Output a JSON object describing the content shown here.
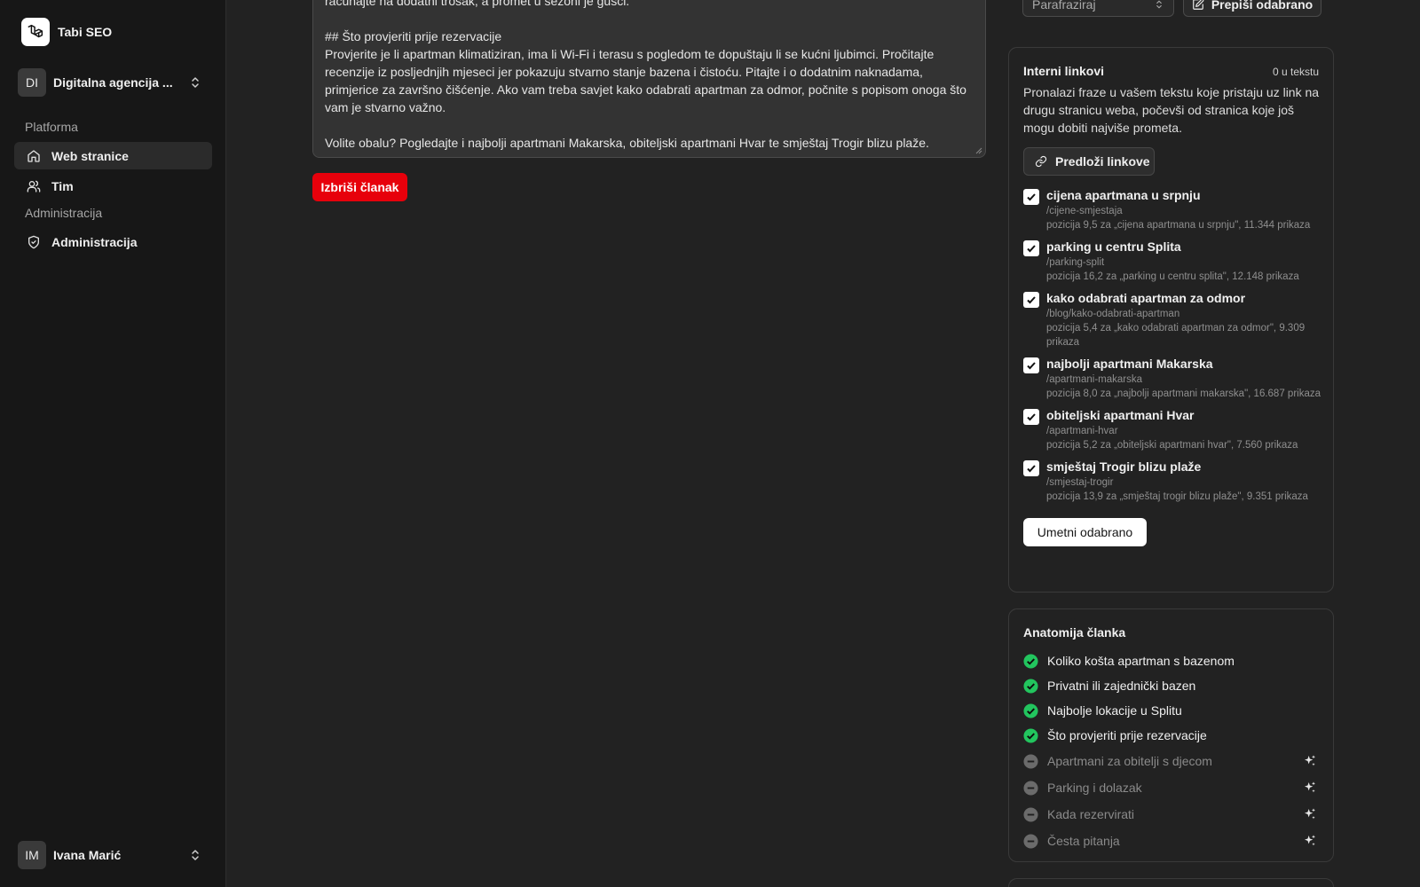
{
  "app": {
    "name": "Tabi SEO"
  },
  "team": {
    "initials": "DI",
    "name": "Digitalna agencija ..."
  },
  "nav": {
    "group_platform": "Platforma",
    "web_pages": "Web stranice",
    "team": "Tim",
    "group_admin": "Administracija",
    "admin": "Administracija"
  },
  "user": {
    "initials": "IM",
    "name": "Ivana Marić"
  },
  "editor": {
    "partial_line": "računajte na dodatni trošak, a promet u sezoni je gušći.",
    "heading": "## Što provjeriti prije rezervacije",
    "paragraph": "Provjerite je li apartman klimatiziran, ima li Wi-Fi i terasu s pogledom te dopuštaju li se kućni ljubimci. Pročitajte recenzije iz posljednjih mjeseci jer pokazuju stvarno stanje bazena i čistoću. Pitajte i o dodatnim naknadama, primjerice za završno čišćenje. Ako vam treba savjet kako odabrati apartman za odmor, počnite s popisom onoga što vam je stvarno važno.",
    "closing": "Volite obalu? Pogledajte i najbolji apartmani Makarska, obiteljski apartmani Hvar te smještaj Trogir blizu plaže."
  },
  "delete_button": "Izbriši članak",
  "rewrite": {
    "mode": "Parafraziraj",
    "button": "Prepiši odabrano"
  },
  "internal_links": {
    "title": "Interni linkovi",
    "count": "0 u tekstu",
    "description": "Pronalazi fraze u vašem tekstu koje pristaju uz link na drugu stranicu weba, počevši od stranica koje još mogu dobiti najviše prometa.",
    "suggest_button": "Predloži linkove",
    "insert_button": "Umetni odabrano",
    "items": [
      {
        "checked": true,
        "title": "cijena apartmana u srpnju",
        "url": "/cijene-smjestaja",
        "meta": "pozicija 9,5 za „cijena apartmana u srpnju\", 11.344 prikaza"
      },
      {
        "checked": true,
        "title": "parking u centru Splita",
        "url": "/parking-split",
        "meta": "pozicija 16,2 za „parking u centru splita\", 12.148 prikaza"
      },
      {
        "checked": true,
        "title": "kako odabrati apartman za odmor",
        "url": "/blog/kako-odabrati-apartman",
        "meta": "pozicija 5,4 za „kako odabrati apartman za odmor\", 9.309 prikaza"
      },
      {
        "checked": true,
        "title": "najbolji apartmani Makarska",
        "url": "/apartmani-makarska",
        "meta": "pozicija 8,0 za „najbolji apartmani makarska\", 16.687 prikaza"
      },
      {
        "checked": true,
        "title": "obiteljski apartmani Hvar",
        "url": "/apartmani-hvar",
        "meta": "pozicija 5,2 za „obiteljski apartmani hvar\", 7.560 prikaza"
      },
      {
        "checked": true,
        "title": "smještaj Trogir blizu plaže",
        "url": "/smjestaj-trogir",
        "meta": "pozicija 13,9 za „smještaj trogir blizu plaže\", 9.351 prikaza"
      }
    ]
  },
  "anatomy": {
    "title": "Anatomija članka",
    "done": [
      "Koliko košta apartman s bazenom",
      "Privatni ili zajednički bazen",
      "Najbolje lokacije u Splitu",
      "Što provjeriti prije rezervacije"
    ],
    "pending": [
      "Apartmani za obitelji s djecom",
      "Parking i dolazak",
      "Kada rezervirati",
      "Česta pitanja"
    ],
    "status_colors": {
      "done": "#22c55e",
      "pending": "#6b6b6b"
    }
  }
}
